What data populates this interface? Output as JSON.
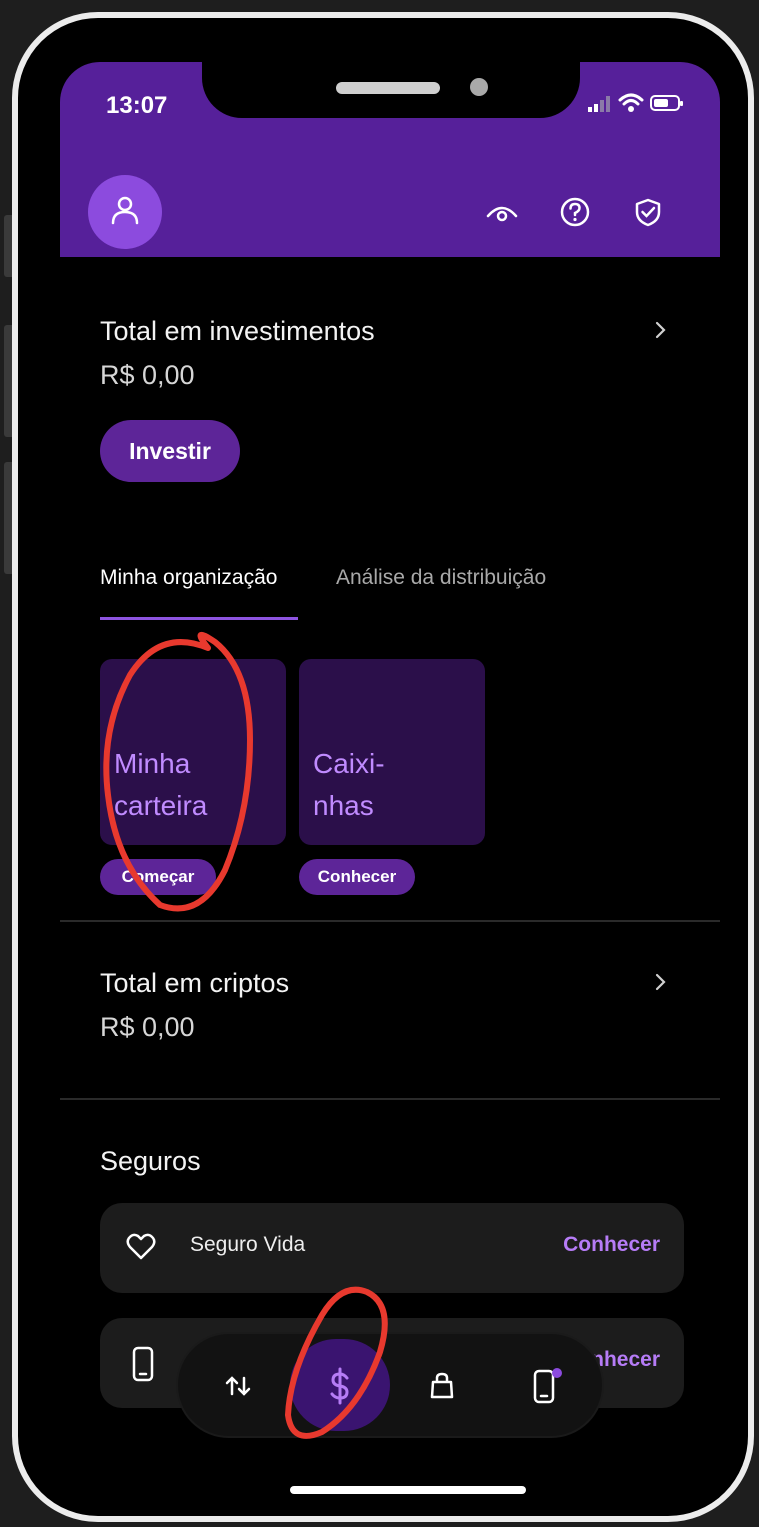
{
  "status_bar": {
    "time": "13:07"
  },
  "header": {
    "profile_icon": "user-icon",
    "icons": [
      "eye-icon",
      "help-circle-icon",
      "shield-check-icon"
    ]
  },
  "investments": {
    "title": "Total em investimentos",
    "amount": "R$ 0,00",
    "button": "Investir"
  },
  "tabs": [
    {
      "label": "Minha organização",
      "active": true
    },
    {
      "label": "Análise da distribuição",
      "active": false
    }
  ],
  "cards": [
    {
      "label": "Minha\ncarteira",
      "cta": "Começar"
    },
    {
      "label": "Caixi-\nnhas",
      "cta": "Conhecer"
    }
  ],
  "crypto": {
    "title": "Total em criptos",
    "amount": "R$ 0,00"
  },
  "insurance": {
    "title": "Seguros",
    "items": [
      {
        "name": "Seguro Vida",
        "cta": "Conhecer",
        "icon": "heart-icon"
      },
      {
        "name": "",
        "cta": "Conhecer",
        "icon": "phone-icon"
      }
    ]
  },
  "bottom_nav": {
    "items": [
      {
        "icon": "transfer-arrows-icon",
        "active": false
      },
      {
        "icon": "dollar-icon",
        "active": true
      },
      {
        "icon": "shopping-bag-icon",
        "active": false
      },
      {
        "icon": "phone-icon",
        "active": false,
        "badge": true
      }
    ]
  },
  "colors": {
    "brand_purple": "#56209a",
    "accent": "#b67cf6",
    "annotation_red": "#e8392e",
    "background": "#000000"
  }
}
